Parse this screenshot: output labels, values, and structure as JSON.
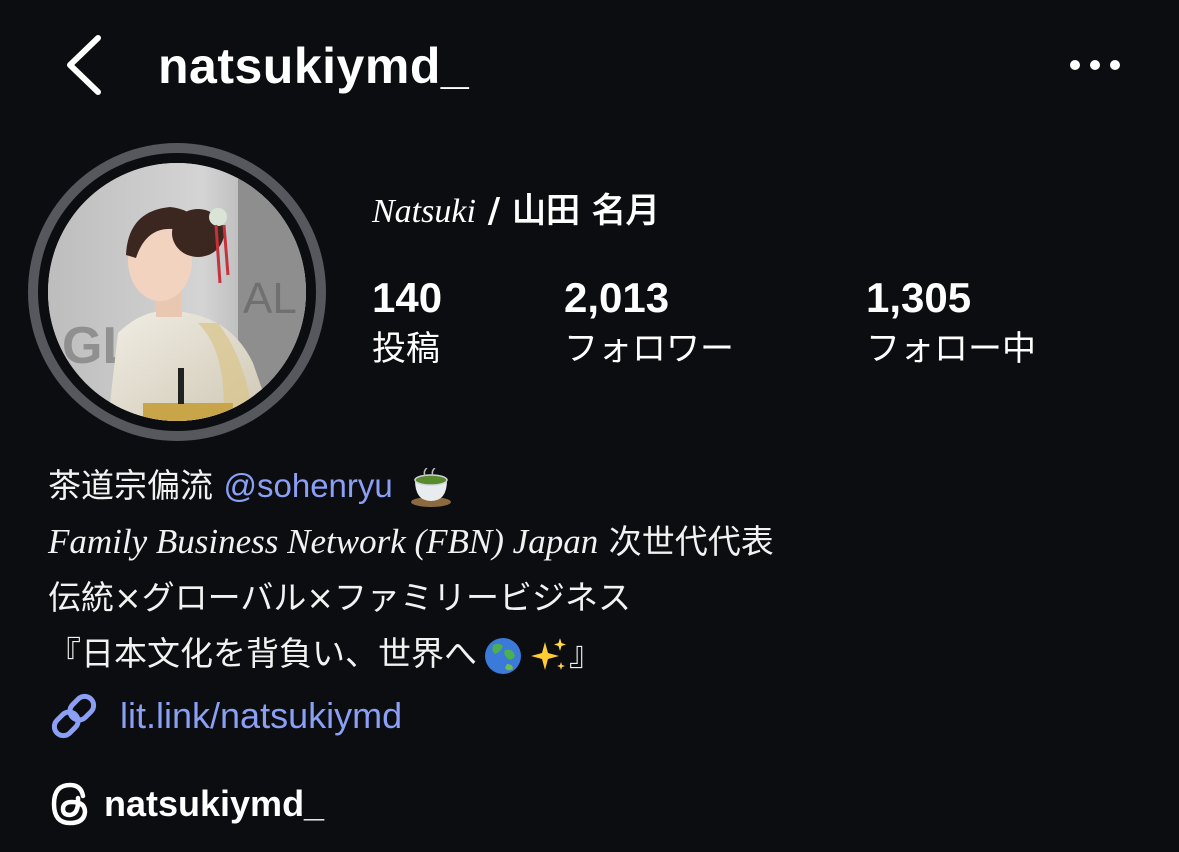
{
  "header": {
    "username": "natsukiymd_",
    "back_icon": "chevron-left-icon",
    "more_icon": "ellipsis-icon"
  },
  "profile": {
    "name_latin": "Natsuki",
    "name_separator": " / ",
    "name_jp": "山田 名月",
    "stats": {
      "posts_count": "140",
      "posts_label": "投稿",
      "followers_count": "2,013",
      "followers_label": "フォロワー",
      "following_count": "1,305",
      "following_label": "フォロー中"
    }
  },
  "bio": {
    "line1_text": "茶道宗偏流 ",
    "line1_mention": "@sohenryu",
    "line1_emoji": "tea-cup-icon",
    "line2_latin": "Family Business Network (FBN) Japan",
    "line2_jp": " 次世代代表",
    "line3": "伝統×グローバル×ファミリービジネス",
    "line4_text": "『日本文化を背負い、世界へ",
    "line4_end": "』",
    "line4_emojis": [
      "globe-icon",
      "sparkles-icon"
    ]
  },
  "link": {
    "icon": "link-icon",
    "text": "lit.link/natsukiymd"
  },
  "threads": {
    "icon": "threads-icon",
    "handle": "natsukiymd_"
  },
  "colors": {
    "background": "#0c0d10",
    "link_blue": "#8b9ff5",
    "ring": "#56585e",
    "text": "#ffffff"
  }
}
